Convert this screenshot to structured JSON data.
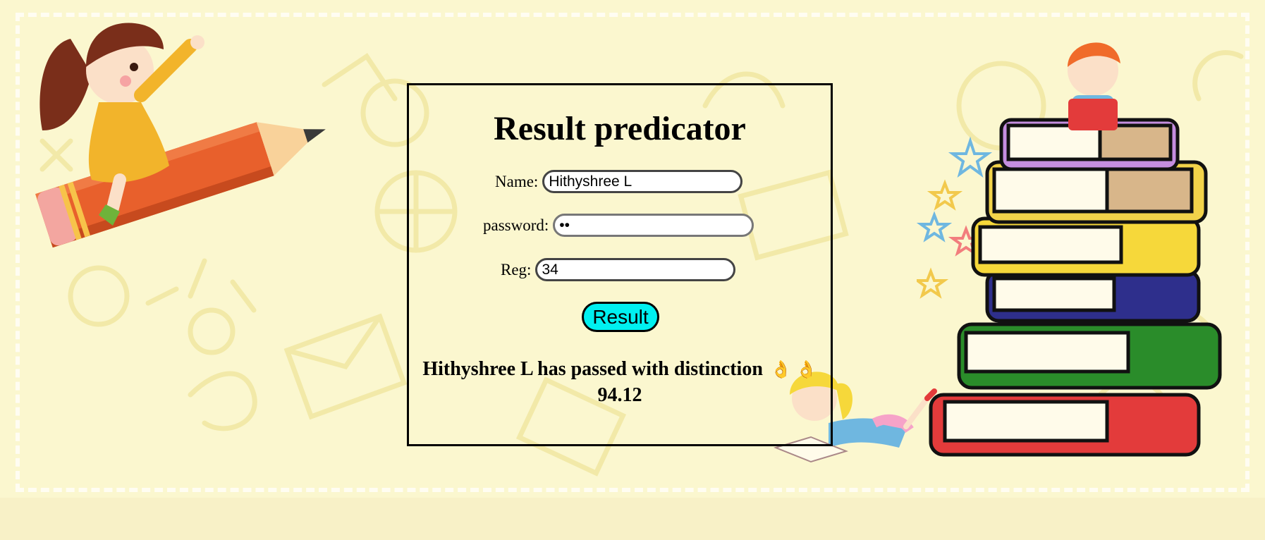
{
  "form": {
    "title": "Result predicator",
    "name_label": "Name:",
    "name_value": "Hithyshree L",
    "password_label": "password:",
    "password_value": "••",
    "reg_label": "Reg:",
    "reg_value": "34",
    "submit_label": "Result"
  },
  "result": {
    "message": "Hithyshree L has passed with distinction",
    "emoji": "👌 👌",
    "score": "94.12"
  },
  "colors": {
    "background": "#fbf7cf",
    "button": "#00f0f0",
    "border": "#000000"
  },
  "icons": {
    "decorations": [
      "pencil-girl-illustration",
      "book-stack-illustration",
      "reading-girl-illustration",
      "star-icon"
    ]
  }
}
